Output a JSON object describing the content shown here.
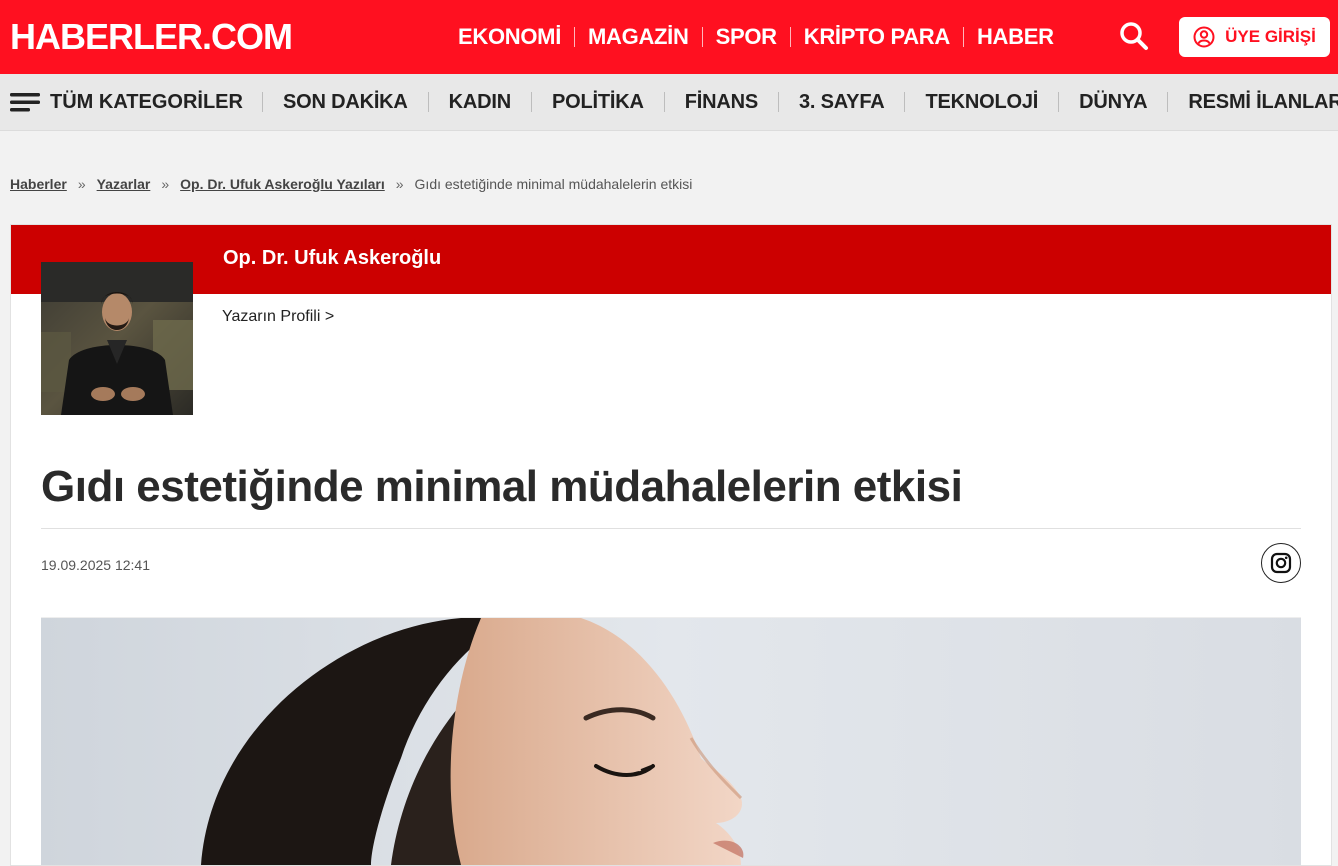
{
  "header": {
    "logo": "HABERLER.COM",
    "nav": [
      "EKONOMİ",
      "MAGAZİN",
      "SPOR",
      "KRİPTO PARA",
      "HABER"
    ],
    "login_label": "ÜYE GİRİŞİ",
    "brand_color": "#ff1020"
  },
  "categories": {
    "all_label": "TÜM KATEGORİLER",
    "items": [
      "SON DAKİKA",
      "KADIN",
      "POLİTİKA",
      "FİNANS",
      "3. SAYFA",
      "TEKNOLOJİ",
      "DÜNYA",
      "RESMİ İLANLAR"
    ]
  },
  "breadcrumb": {
    "links": [
      "Haberler",
      "Yazarlar",
      "Op. Dr. Ufuk Askeroğlu Yazıları"
    ],
    "separator": "»",
    "current": "Gıdı estetiğinde minimal müdahalelerin etkisi"
  },
  "author": {
    "name": "Op. Dr. Ufuk Askeroğlu",
    "profile_link": "Yazarın Profili >",
    "band_color": "#cc0000"
  },
  "article": {
    "title": "Gıdı estetiğinde minimal müdahalelerin etkisi",
    "date": "19.09.2025 12:41"
  },
  "icons": {
    "menu": "hamburger-icon",
    "search": "search-icon",
    "user": "user-icon",
    "share": "instagram-icon"
  }
}
